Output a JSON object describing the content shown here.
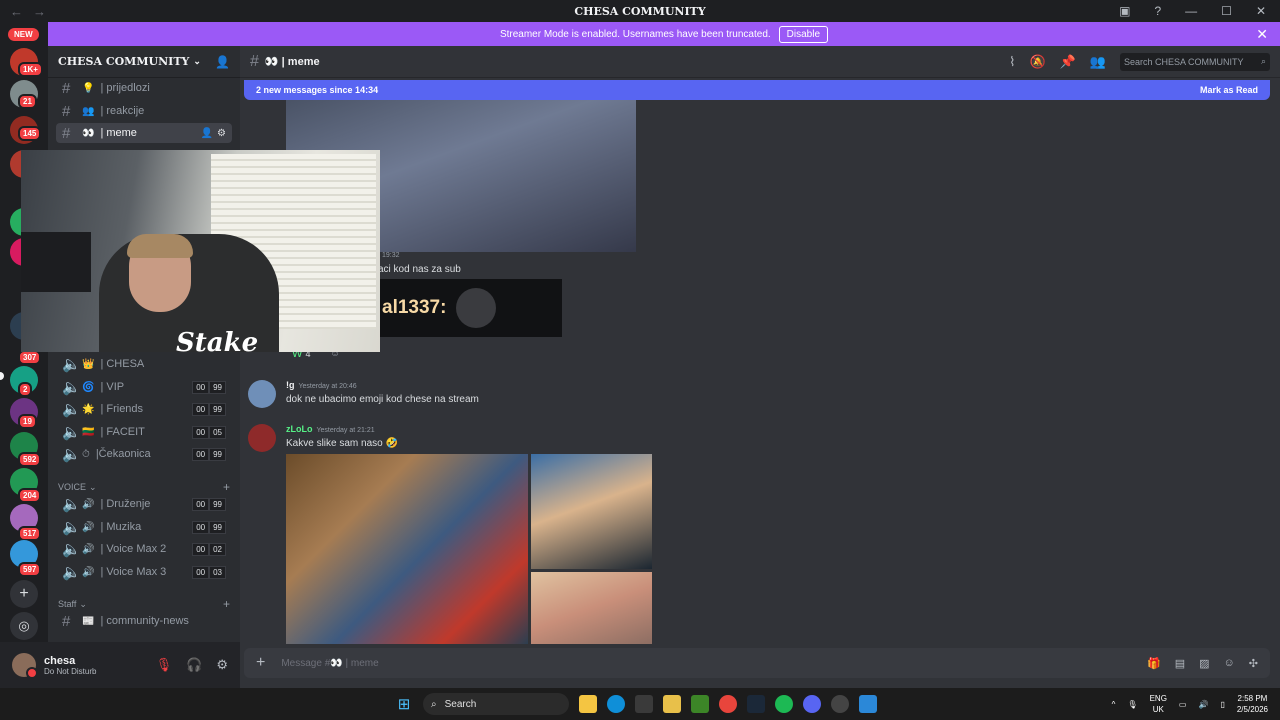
{
  "window": {
    "title": "CHESA COMMUNITY",
    "back": "←",
    "forward": "→"
  },
  "servers": {
    "new_label": "NEW",
    "badges": [
      "1K+",
      "21",
      "145",
      "307",
      "2",
      "19",
      "592",
      "204",
      "517",
      "597"
    ]
  },
  "banner": {
    "text": "Streamer Mode is enabled. Usernames have been truncated.",
    "disable_label": "Disable"
  },
  "guild": {
    "name": "CHESA COMMUNITY"
  },
  "channels_top": [
    {
      "emoji": "💡",
      "name": "| prijedlozi"
    },
    {
      "emoji": "👥",
      "name": "| reakcije"
    },
    {
      "emoji": "👀",
      "name": "| meme"
    }
  ],
  "voice_top": [
    {
      "emoji": "👑",
      "name": "| CHESA",
      "a": "",
      "b": ""
    },
    {
      "emoji": "🌀",
      "name": "| VIP",
      "a": "00",
      "b": "99"
    },
    {
      "emoji": "🌟",
      "name": "| Friends",
      "a": "00",
      "b": "99"
    },
    {
      "emoji": "🇱🇹",
      "name": "| FACEIT",
      "a": "00",
      "b": "05"
    },
    {
      "emoji": "⏱",
      "name": "|Čekaonica",
      "a": "00",
      "b": "99"
    }
  ],
  "voice_category": "VOICE",
  "voice_channels": [
    {
      "emoji": "🔊",
      "name": "| Druženje",
      "a": "00",
      "b": "99"
    },
    {
      "emoji": "🔊",
      "name": "| Muzika",
      "a": "00",
      "b": "99"
    },
    {
      "emoji": "🔊",
      "name": "| Voice Max 2",
      "a": "00",
      "b": "02"
    },
    {
      "emoji": "🔊",
      "name": "| Voice Max 3",
      "a": "00",
      "b": "03"
    }
  ],
  "staff_category": "Staff",
  "staff_channel": {
    "emoji": "📰",
    "name": "| community-news"
  },
  "webcam": {
    "logo": "Stake"
  },
  "user": {
    "name": "chesa",
    "status": "Do Not Disturb"
  },
  "header": {
    "channel": "👀 | meme",
    "search_placeholder": "Search CHESA COMMUNITY"
  },
  "new_messages": {
    "text": "2 new messages since 14:34",
    "mark_label": "Mark as Read"
  },
  "partial_messages": {
    "time": "19:32",
    "text": "aci kod nas za sub",
    "embed_text": "al1337:",
    "reaction_count": "4"
  },
  "messages": [
    {
      "author": "!g",
      "time": "Yesterday at 20:46",
      "text": "dok ne ubacimo emoji kod chese na stream",
      "color": "#f2f3f5"
    },
    {
      "author": "zLoLo",
      "time": "Yesterday at 21:21",
      "text": "Kakve slike sam naso 🤣",
      "color": "#57f287"
    }
  ],
  "composer": {
    "placeholder": "Message #👀 | meme"
  },
  "taskbar": {
    "search": "Search",
    "lang1": "ENG",
    "lang2": "UK",
    "time": "2:58 PM",
    "date": "2/5/2026"
  }
}
